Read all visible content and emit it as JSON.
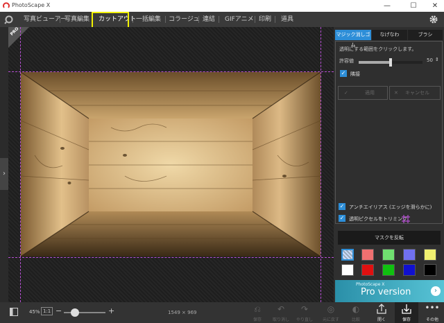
{
  "window": {
    "title": "PhotoScape X",
    "minimize": "—",
    "maximize": "☐",
    "close": "✕"
  },
  "menu": {
    "items": [
      "写真ビューアー",
      "写真編集",
      "カットアウト",
      "一括編集",
      "コラージュ",
      "連結",
      "GIFアニメ",
      "印刷",
      "道具"
    ],
    "active_index": 2
  },
  "badges": {
    "pro": "PRO"
  },
  "panel": {
    "tabs": [
      "マジック消しゴム",
      "なげなわ",
      "ブラシ"
    ],
    "instruction": "透明にする範囲をクリックします。",
    "tolerance_label": "許容値",
    "tolerance_value": "50",
    "tolerance_fraction": 0.5,
    "adjacent_label": "隣接",
    "apply_label": "適用",
    "cancel_label": "キャンセル",
    "antialias_label": "アンチエイリアス (エッジを滑らかに)",
    "trim_label": "透明ピクセルをトリミング",
    "invert_label": "マスクを反転",
    "swatches": [
      "#cfd8ff",
      "#f07070",
      "#70e070",
      "#7070f0",
      "#f0f070",
      "#ffffff",
      "#e01010",
      "#10c010",
      "#1010d0",
      "#000000"
    ],
    "pro_small": "PhotoScape X",
    "pro_big": "Pro version"
  },
  "bottom": {
    "zoom": "45%",
    "ratio": "1:1",
    "minus": "−",
    "plus": "+",
    "zoom_fraction": 0.27,
    "dimensions": "1549 × 969",
    "actions": [
      "保存",
      "取り消し",
      "やり直し",
      "元に戻す",
      "比較"
    ],
    "open_label": "開く",
    "save_label": "保存",
    "more_label": "その他"
  },
  "colors": {
    "accent": "#2d8ed8",
    "highlight": "#f2f200",
    "guide": "#b84fd6"
  }
}
